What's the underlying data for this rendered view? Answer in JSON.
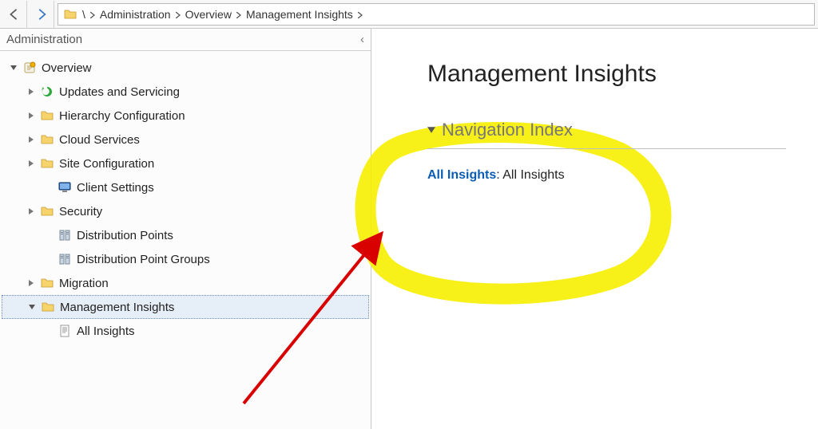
{
  "toolbar": {
    "back_icon": "back",
    "forward_icon": "forward"
  },
  "breadcrumb": {
    "root_icon": "folder",
    "segments": [
      "\\",
      "Administration",
      "Overview",
      "Management Insights"
    ]
  },
  "sidebar": {
    "title": "Administration",
    "items": [
      {
        "label": "Overview",
        "indent": 0,
        "expander": "down",
        "icon": "overview"
      },
      {
        "label": "Updates and Servicing",
        "indent": 1,
        "expander": "right",
        "icon": "updates"
      },
      {
        "label": "Hierarchy Configuration",
        "indent": 1,
        "expander": "right",
        "icon": "folder"
      },
      {
        "label": "Cloud Services",
        "indent": 1,
        "expander": "right",
        "icon": "folder"
      },
      {
        "label": "Site Configuration",
        "indent": 1,
        "expander": "right",
        "icon": "folder"
      },
      {
        "label": "Client Settings",
        "indent": 2,
        "expander": "none",
        "icon": "monitor"
      },
      {
        "label": "Security",
        "indent": 1,
        "expander": "right",
        "icon": "folder"
      },
      {
        "label": "Distribution Points",
        "indent": 2,
        "expander": "none",
        "icon": "dp"
      },
      {
        "label": "Distribution Point Groups",
        "indent": 2,
        "expander": "none",
        "icon": "dpg"
      },
      {
        "label": "Migration",
        "indent": 1,
        "expander": "right",
        "icon": "folder"
      },
      {
        "label": "Management Insights",
        "indent": 1,
        "expander": "down",
        "icon": "folder",
        "selected": true
      },
      {
        "label": "All Insights",
        "indent": 2,
        "expander": "none",
        "icon": "doc"
      }
    ]
  },
  "main": {
    "title": "Management Insights",
    "section_title": "Navigation Index",
    "link_label": "All Insights",
    "link_value": "All Insights"
  },
  "annotation": {
    "highlight": true,
    "arrow": true
  }
}
